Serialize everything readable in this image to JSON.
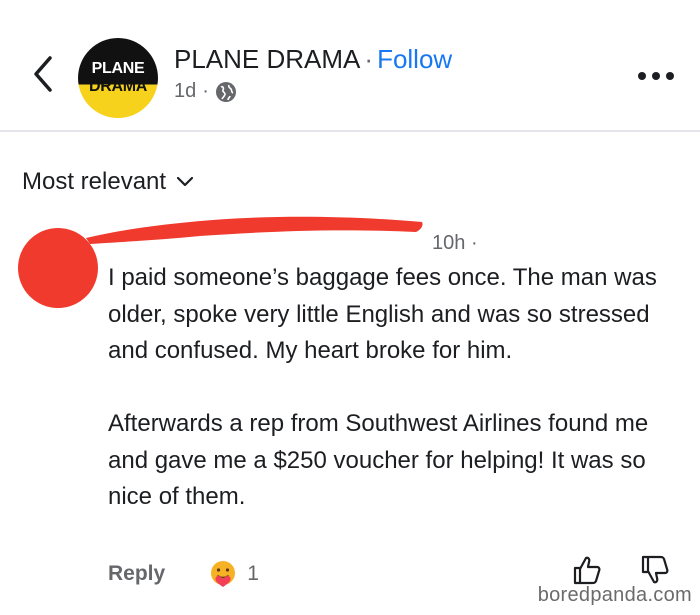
{
  "header": {
    "avatar_line1": "PLANE",
    "avatar_line2": "DRAMA",
    "page_name": "PLANE DRAMA",
    "separator": "·",
    "follow_label": "Follow",
    "time": "1d",
    "meta_separator": "·"
  },
  "sort": {
    "label": "Most relevant"
  },
  "comment": {
    "time": "10h",
    "time_suffix": "·",
    "paragraph1": "I paid someone’s baggage fees once. The man was older, spoke very little English and was so stressed and confused. My heart broke for him.",
    "paragraph2": "Afterwards a rep from Southwest Airlines found me and gave me a $250 voucher for helping! It was so nice of them.",
    "reply_label": "Reply",
    "reaction_count": "1"
  },
  "watermark": "boredpanda.com",
  "colors": {
    "accent": "#1877f2",
    "redaction": "#f03a2e",
    "muted": "#65676b"
  },
  "icons": [
    "back-chevron-icon",
    "globe-icon",
    "more-dots-icon",
    "chevron-down-icon",
    "care-reaction-icon",
    "thumbs-up-icon",
    "thumbs-down-icon"
  ]
}
